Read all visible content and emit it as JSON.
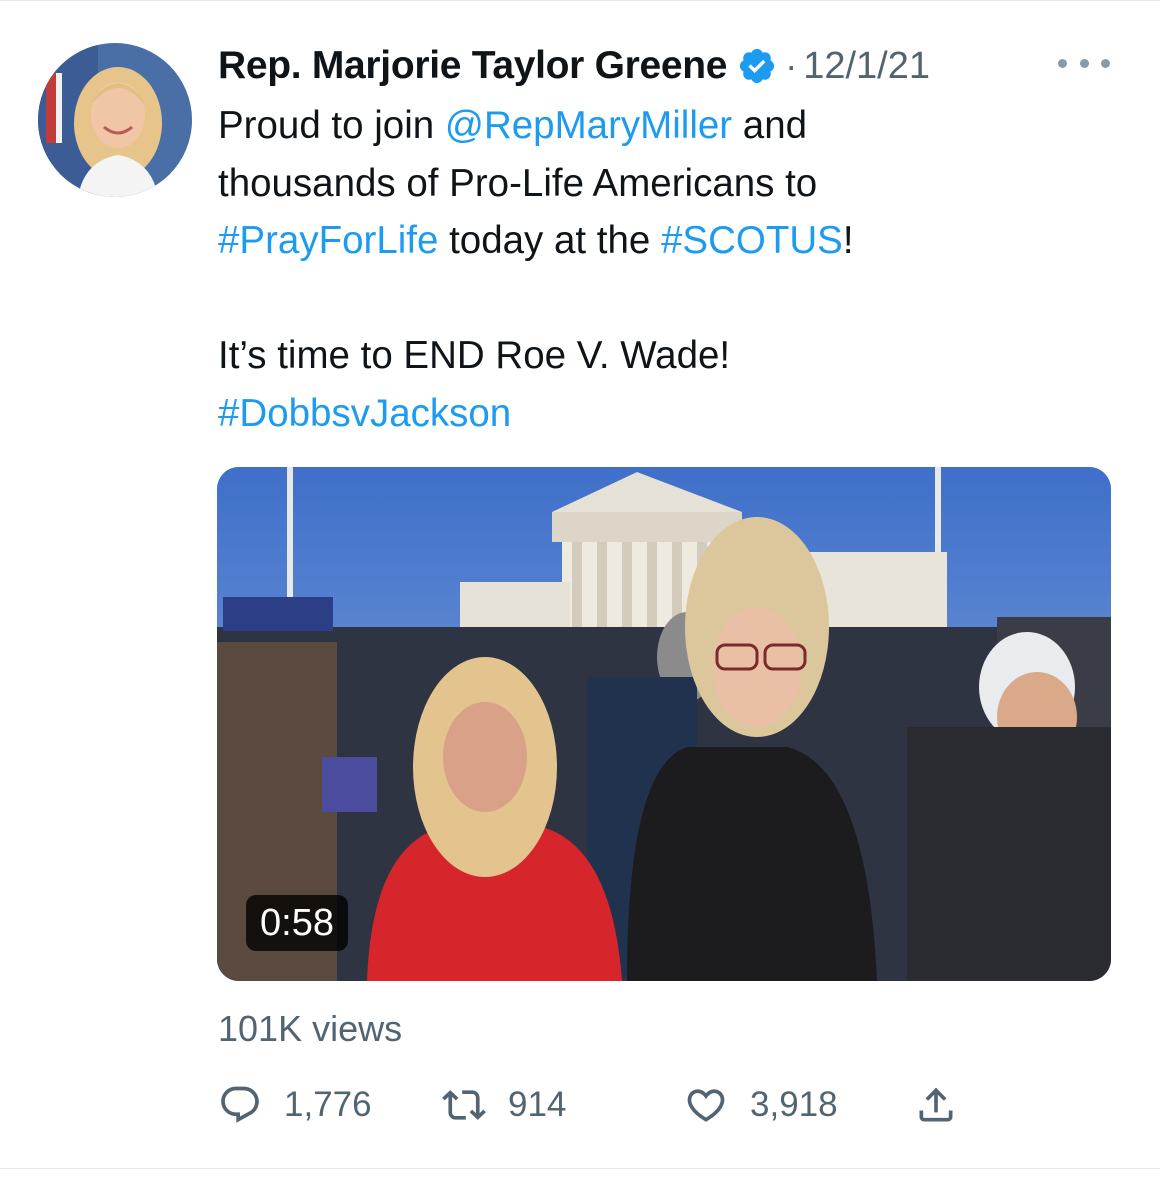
{
  "tweet": {
    "author_name": "Rep. Marjorie Taylor Greene",
    "separator": "·",
    "date": "12/1/21",
    "text": {
      "line1": {
        "t1": "Proud to join ",
        "mention": "@RepMaryMiller",
        "t2": " and"
      },
      "line2": "thousands of Pro-Life Americans to",
      "line3": {
        "hashtag1": "#PrayForLife",
        "t1": " today at the ",
        "hashtag2": "#SCOTUS",
        "t2": "!"
      },
      "line4": "It’s time to END Roe V. Wade!",
      "line5": "#DobbsvJackson"
    },
    "video": {
      "duration": "0:58"
    },
    "views": "101K views",
    "stats": {
      "replies": "1,776",
      "retweets": "914",
      "likes": "3,918"
    }
  },
  "icons": {
    "verified": "verified-badge-icon",
    "more": "more-options-icon",
    "reply": "reply-icon",
    "retweet": "retweet-icon",
    "like": "heart-icon",
    "share": "share-icon"
  },
  "colors": {
    "link": "#1d9bf0",
    "secondary_text": "#536471",
    "primary_text": "#0f1419",
    "verified": "#1d9bf0"
  }
}
